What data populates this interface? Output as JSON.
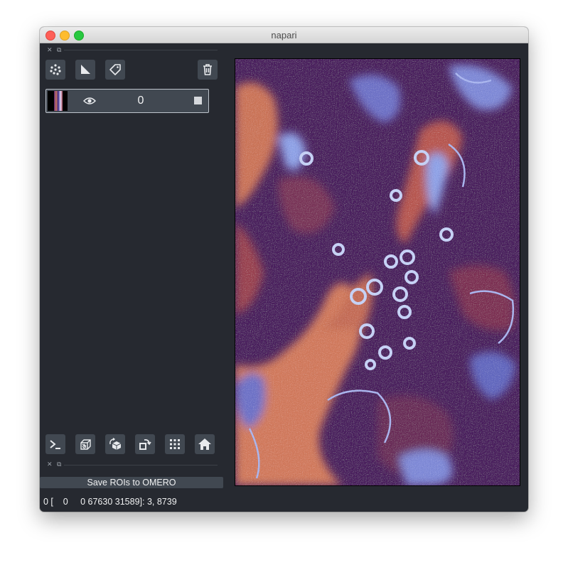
{
  "window": {
    "title": "napari"
  },
  "dock_top": {
    "close_glyph": "✕",
    "float_glyph": "⧉"
  },
  "dock_bottom": {
    "close_glyph": "✕",
    "float_glyph": "⧉"
  },
  "layer_tools": [
    {
      "icon": "new-points-icon"
    },
    {
      "icon": "new-shapes-icon"
    },
    {
      "icon": "new-labels-icon"
    },
    {
      "icon": "delete-layer-icon"
    }
  ],
  "layers": [
    {
      "name": "0",
      "visible": true,
      "icon": "eye-icon"
    }
  ],
  "viewer_buttons": [
    {
      "icon": "console-icon"
    },
    {
      "icon": "ndisplay-icon"
    },
    {
      "icon": "roll-dims-icon"
    },
    {
      "icon": "transpose-icon"
    },
    {
      "icon": "grid-icon"
    },
    {
      "icon": "home-icon"
    }
  ],
  "plugin": {
    "save_label": "Save ROIs to OMERO"
  },
  "status": {
    "text": "0 [    0     0 67630 31589]: 3, 8739"
  },
  "colors": {
    "panel_bg": "#262930",
    "button_bg": "#414851",
    "image_dark": "#4a1d5e",
    "image_orange": "#d27a5c",
    "image_blue": "#8fa3e8"
  }
}
